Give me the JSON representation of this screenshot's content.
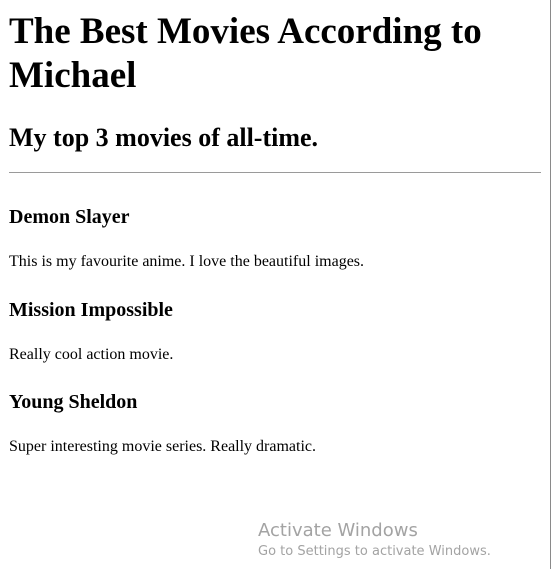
{
  "page": {
    "title": "The Best Movies According to Michael",
    "subtitle": "My top 3 movies of all-time."
  },
  "movies": [
    {
      "title": "Demon Slayer",
      "description": "This is my favourite anime. I love the beautiful images."
    },
    {
      "title": "Mission Impossible",
      "description": "Really cool action movie."
    },
    {
      "title": "Young Sheldon",
      "description": "Super interesting movie series. Really dramatic."
    }
  ],
  "watermark": {
    "title": "Activate Windows",
    "subtitle": "Go to Settings to activate Windows."
  }
}
